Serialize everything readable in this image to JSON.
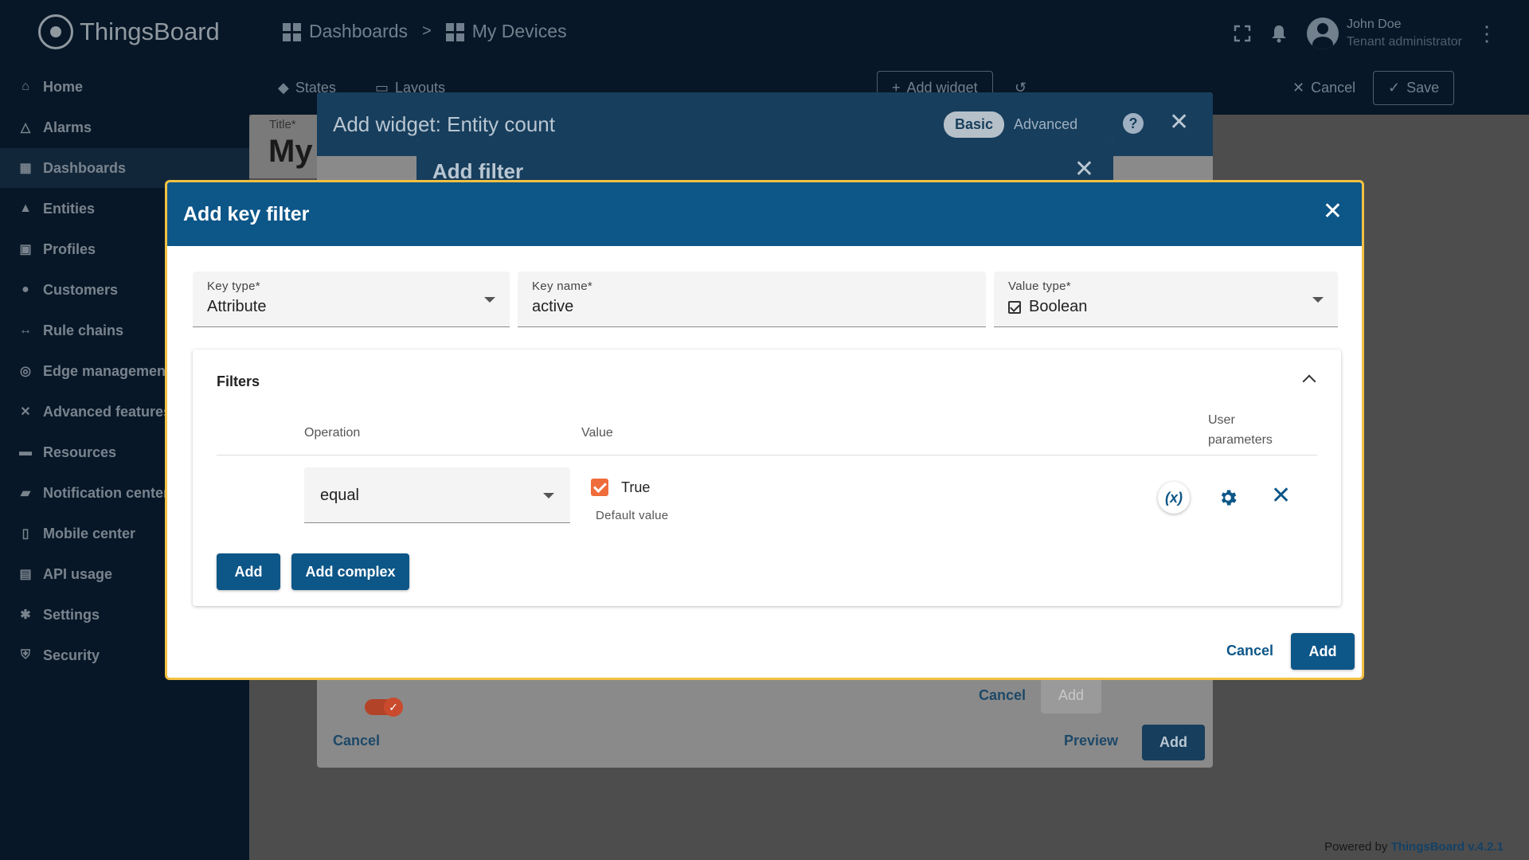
{
  "app": {
    "name": "ThingsBoard"
  },
  "breadcrumb": {
    "item1": "Dashboards",
    "separator": ">",
    "item2": "My Devices"
  },
  "user": {
    "name": "John Doe",
    "role": "Tenant administrator"
  },
  "sidebar": {
    "items": [
      {
        "label": "Home",
        "icon": "home-icon"
      },
      {
        "label": "Alarms",
        "icon": "alarm-icon"
      },
      {
        "label": "Dashboards",
        "icon": "dashboard-icon"
      },
      {
        "label": "Entities",
        "icon": "entities-icon"
      },
      {
        "label": "Profiles",
        "icon": "profiles-icon"
      },
      {
        "label": "Customers",
        "icon": "customers-icon"
      },
      {
        "label": "Rule chains",
        "icon": "rule-chain-icon"
      },
      {
        "label": "Edge management",
        "icon": "edge-icon"
      },
      {
        "label": "Advanced features",
        "icon": "advanced-icon"
      },
      {
        "label": "Resources",
        "icon": "folder-icon"
      },
      {
        "label": "Notification center",
        "icon": "notification-icon"
      },
      {
        "label": "Mobile center",
        "icon": "mobile-icon"
      },
      {
        "label": "API usage",
        "icon": "api-usage-icon"
      },
      {
        "label": "Settings",
        "icon": "gear-icon"
      },
      {
        "label": "Security",
        "icon": "shield-icon"
      }
    ]
  },
  "toolbar": {
    "states": "States",
    "layouts": "Layouts",
    "add_widget": "Add widget",
    "cancel": "Cancel",
    "save": "Save"
  },
  "add_widget_dialog": {
    "title": "Add widget:",
    "subtitle": "Entity count",
    "basic": "Basic",
    "advanced": "Advanced",
    "help": "?",
    "title_field_label": "Title*",
    "title_field_value": "My",
    "cancel": "Cancel",
    "preview": "Preview",
    "add": "Add"
  },
  "add_filter_dialog": {
    "title": "Add filter",
    "cancel": "Cancel",
    "add": "Add"
  },
  "key_filter_dialog": {
    "title": "Add key filter",
    "key_type": {
      "label": "Key type*",
      "value": "Attribute"
    },
    "key_name": {
      "label": "Key name*",
      "value": "active"
    },
    "value_type": {
      "label": "Value type*",
      "value": "Boolean"
    },
    "filters": {
      "title": "Filters",
      "columns": {
        "operation": "Operation",
        "value": "Value",
        "user_params_1": "User",
        "user_params_2": "parameters"
      },
      "row": {
        "operation": "equal",
        "value_label": "True",
        "value_checked": true,
        "hint": "Default value",
        "fx": "(x)"
      },
      "add": "Add",
      "add_complex": "Add complex"
    },
    "cancel": "Cancel",
    "add": "Add"
  },
  "footer": {
    "powered_by": "Powered by",
    "brand_version": "ThingsBoard v.4.2.1"
  },
  "colors": {
    "primary": "#0d5688",
    "accent": "#ef6c3b",
    "highlight_border": "#f3c042",
    "nav_bg": "#0a2036"
  }
}
